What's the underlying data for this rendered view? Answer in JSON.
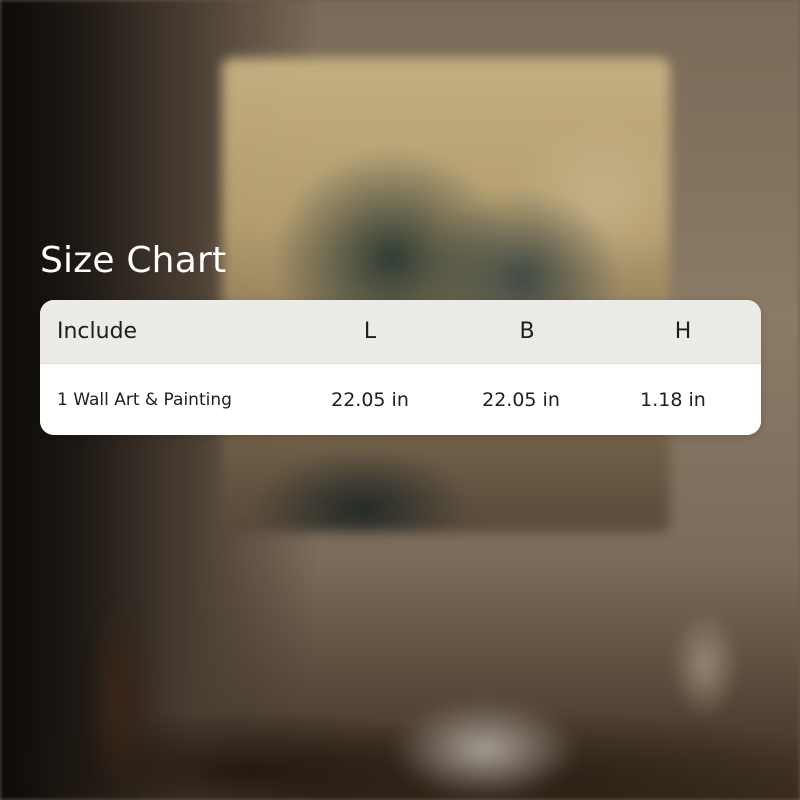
{
  "title": "Size Chart",
  "table": {
    "headers": [
      "Include",
      "L",
      "B",
      "H"
    ],
    "rows": [
      [
        "1 Wall Art & Painting",
        "22.05 in",
        "22.05 in",
        "1.18 in"
      ]
    ]
  },
  "colors": {
    "header_background": "#ecebe7",
    "body_background": "#ffffff",
    "text": "#1e1e1e",
    "title_text": "#ffffff"
  }
}
